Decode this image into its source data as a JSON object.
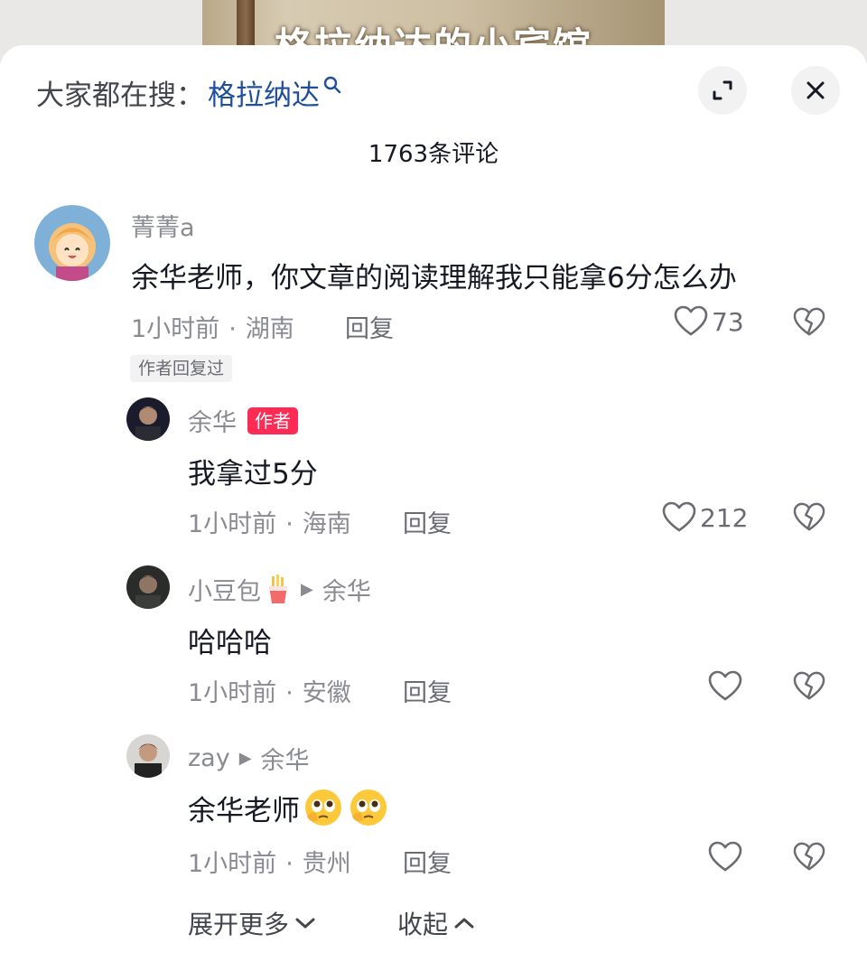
{
  "video": {
    "caption": "格拉纳达的小宾馆"
  },
  "search": {
    "prefix": "大家都在搜：",
    "term": "格拉纳达"
  },
  "header": {
    "comment_count": "1763条评论"
  },
  "comments": [
    {
      "user": "菁菁a",
      "text": "余华老师，你文章的阅读理解我只能拿6分怎么办",
      "time": "1小时前",
      "location": "湖南",
      "reply_label": "回复",
      "likes": "73",
      "tag": "作者回复过"
    }
  ],
  "replies": [
    {
      "user": "余华",
      "badge": "作者",
      "text": "我拿过5分",
      "time": "1小时前",
      "location": "海南",
      "reply_label": "回复",
      "likes": "212"
    },
    {
      "user": "小豆包",
      "reply_to": "余华",
      "text": "哈哈哈",
      "time": "1小时前",
      "location": "安徽",
      "reply_label": "回复",
      "likes": ""
    },
    {
      "user": "zay",
      "reply_to": "余华",
      "text": "余华老师",
      "time": "1小时前",
      "location": "贵州",
      "reply_label": "回复",
      "likes": ""
    }
  ],
  "footer": {
    "expand_label": "展开更多",
    "collapse_label": "收起"
  },
  "colors": {
    "link": "#1f4f9a",
    "author_badge": "#fe2c55",
    "muted": "#8a8b91"
  }
}
